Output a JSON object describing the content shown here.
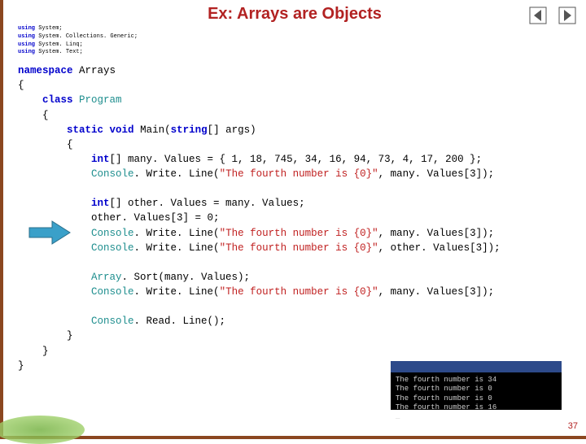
{
  "title": "Ex: Arrays are Objects",
  "page_number": "37",
  "usings": [
    "using System;",
    "using System. Collections. Generic;",
    "using System. Linq;",
    "using System. Text;"
  ],
  "code": {
    "ns_kw": "namespace",
    "ns_name": " Arrays",
    "obrace": "{",
    "class_kw": "class",
    "class_name": "Program",
    "obr2": "{",
    "static_kw": "static",
    "void_kw": "void",
    "main": " Main(",
    "string_kw": "string",
    "args": "[] args)",
    "obr3": "{",
    "int_kw": "int",
    "l1a": "[] many. Values = { 1, 18, 745, 34, 16, 94, 73, 4, 17, 200 };",
    "cons": "Console",
    "wl": ". Write. Line(",
    "s1": "\"The fourth number is {0}\"",
    "l1b": ", many. Values[3]);",
    "l2a": "[] other. Values = many. Values;",
    "l2b": "other. Values[3] = 0;",
    "l2c": ", many. Values[3]);",
    "l2d": ", other. Values[3]);",
    "arr": "Array",
    "sort": ". Sort(many. Values);",
    "l3b": ", many. Values[3]);",
    "rl": ". Read. Line();",
    "cbr3": "}",
    "cbr2": "}",
    "cbr1": "}"
  },
  "console_lines": "The fourth number is 34\nThe fourth number is 0\nThe fourth number is 0\nThe fourth number is 16\n_",
  "nav": {
    "back": "◀",
    "fwd": "▶"
  }
}
